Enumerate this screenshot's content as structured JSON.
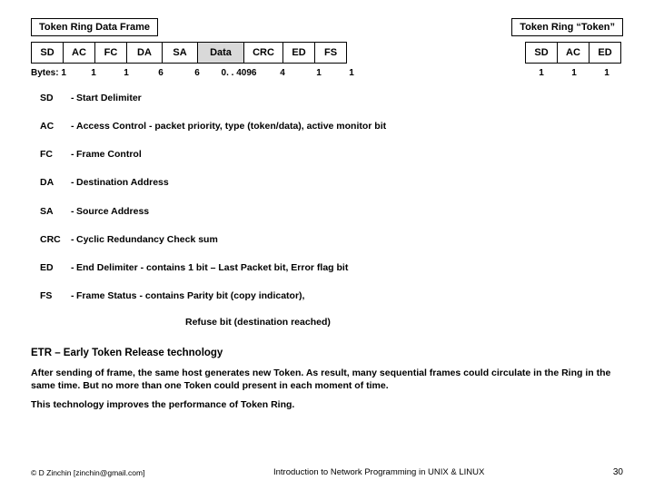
{
  "titles": {
    "data_frame": "Token Ring Data Frame",
    "token": "Token Ring “Token”"
  },
  "data_frame": {
    "fields": [
      "SD",
      "AC",
      "FC",
      "DA",
      "SA",
      "Data",
      "CRC",
      "ED",
      "FS"
    ],
    "bytes_label": "Bytes: 1",
    "bytes": [
      "1",
      "1",
      "6",
      "6",
      "0. . 4096",
      "4",
      "1",
      "1"
    ]
  },
  "token_frame": {
    "fields": [
      "SD",
      "AC",
      "ED"
    ],
    "bytes": [
      "1",
      "1",
      "1"
    ]
  },
  "defs": [
    {
      "abbr": "SD",
      "desc": "Start Delimiter"
    },
    {
      "abbr": "AC",
      "desc": "Access Control - packet priority, type (token/data), active monitor bit"
    },
    {
      "abbr": "FC",
      "desc": "Frame Control"
    },
    {
      "abbr": "DA",
      "desc": "Destination Address"
    },
    {
      "abbr": "SA",
      "desc": "Source Address"
    },
    {
      "abbr": "CRC",
      "desc": "Cyclic Redundancy Check sum"
    },
    {
      "abbr": "ED",
      "desc": "End Delimiter - contains 1 bit – Last Packet bit, Error flag bit"
    },
    {
      "abbr": "FS",
      "desc": "Frame Status - contains Parity bit (copy indicator),"
    }
  ],
  "fs_extra": "Refuse bit (destination reached)",
  "etr": {
    "title": "ETR – Early Token Release technology",
    "p1": "After sending of frame, the same host generates new Token. As result, many sequential frames could circulate in the Ring in the same time. But no more than one Token could present in each moment of time.",
    "p2": "This technology improves the performance of Token Ring."
  },
  "footer": {
    "left": "© D Zinchin [zinchin@gmail.com]",
    "center": "Introduction to Network Programming in UNIX & LINUX",
    "right": "30"
  },
  "chart_data": {
    "type": "table",
    "title": "Token Ring Data Frame field sizes (bytes)",
    "categories": [
      "SD",
      "AC",
      "FC",
      "DA",
      "SA",
      "Data",
      "CRC",
      "ED",
      "FS"
    ],
    "values": [
      "1",
      "1",
      "1",
      "6",
      "6",
      "0..4096",
      "4",
      "1",
      "1"
    ],
    "token_frame": {
      "categories": [
        "SD",
        "AC",
        "ED"
      ],
      "values": [
        "1",
        "1",
        "1"
      ]
    }
  }
}
